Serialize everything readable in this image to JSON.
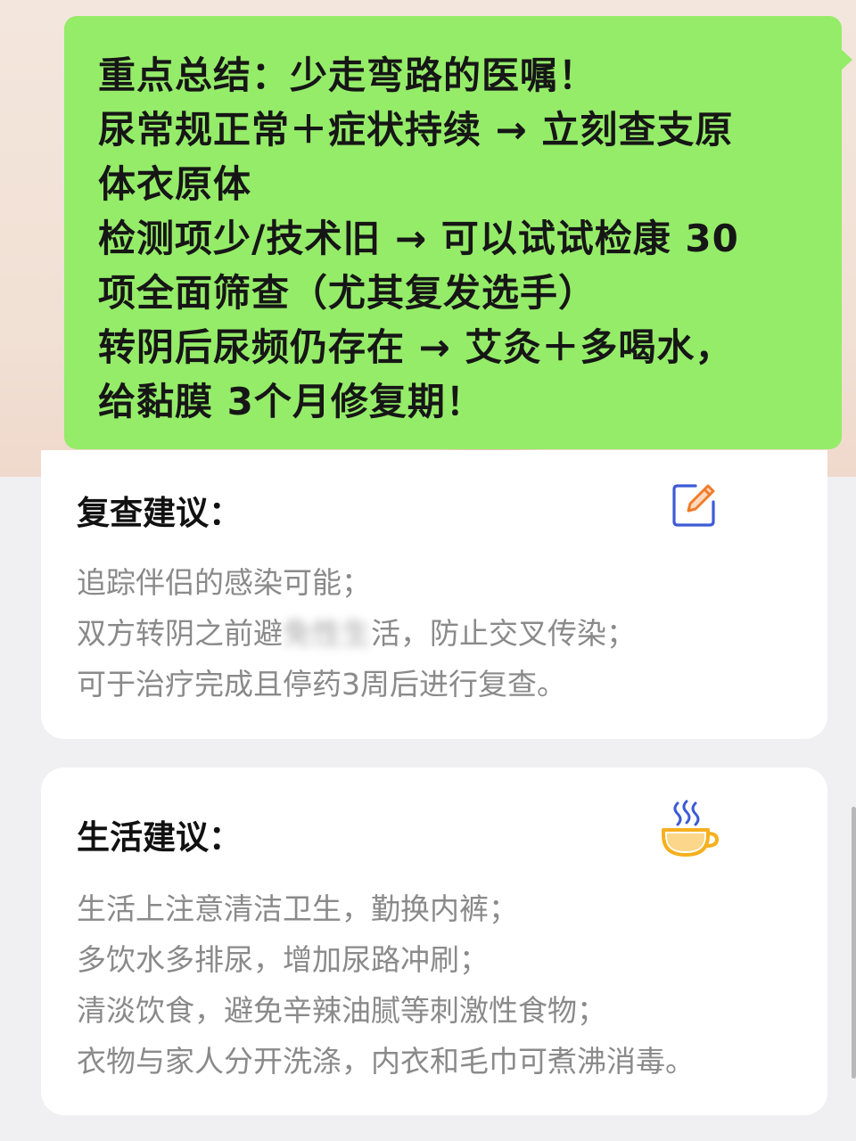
{
  "chat_bubble": {
    "lines": [
      "重点总结：少走弯路的医嘱！",
      "尿常规正常＋症状持续 → 立刻查支原",
      "体衣原体",
      "检测项少/技术旧 → 可以试试检康 30",
      "项全面筛查（尤其复发选手）",
      "转阴后尿频仍存在 → 艾灸＋多喝水，",
      "给黏膜 3个月修复期！"
    ],
    "background_color": "#95ec69"
  },
  "recheck_card": {
    "title": "复查建议：",
    "icon": "edit-icon",
    "line_1": "追踪伴侣的感染可能；",
    "line_2_before": "双方转阴之前避",
    "line_2_blurred": "免性生",
    "line_2_after": "活，防止交叉传染；",
    "line_3": "可于治疗完成且停药3周后进行复查。"
  },
  "lifestyle_card": {
    "title": "生活建议：",
    "icon": "coffee-cup-icon",
    "lines": [
      "生活上注意清洁卫生，勤换内裤；",
      "多饮水多排尿，增加尿路冲刷；",
      "清淡饮食，避免辛辣油腻等刺激性食物；",
      "衣物与家人分开洗涤，内衣和毛巾可煮沸消毒。"
    ]
  },
  "colors": {
    "icon_blue": "#3d5bd6",
    "icon_orange": "#f07c2a",
    "cup_yellow": "#f5b01f",
    "text_gray": "#8a8a8a"
  }
}
